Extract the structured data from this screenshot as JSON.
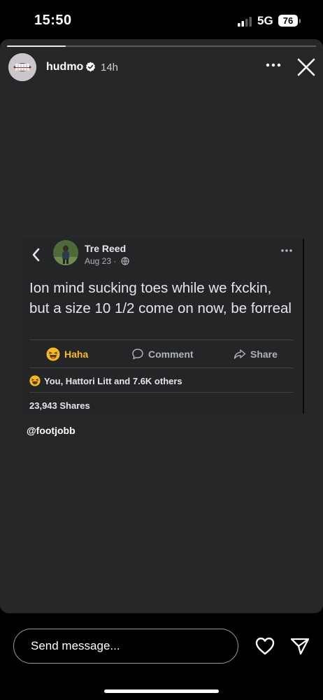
{
  "status_bar": {
    "time": "15:50",
    "network": "5G",
    "battery": "76"
  },
  "story": {
    "progress": 0.19,
    "username": "hudmo",
    "time_ago": "14h",
    "mention": "@footjobb"
  },
  "post": {
    "author": "Tre Reed",
    "date": "Aug 23 ·",
    "text": "Ion mind sucking toes while we fxckin, but a size 10 1/2 come on now, be forreal",
    "actions": {
      "haha": "Haha",
      "comment": "Comment",
      "share": "Share"
    },
    "reactions": "You, Hattori Litt and 7.6K others",
    "shares": "23,943 Shares"
  },
  "reply": {
    "placeholder": "Send message..."
  },
  "colors": {
    "haha": "#f7b928",
    "story_bg": "#272729",
    "post_bg": "#242526"
  },
  "icons": [
    "signal-icon",
    "verified-icon",
    "more-icon",
    "close-icon",
    "back-icon",
    "globe-icon",
    "haha-icon",
    "comment-icon",
    "share-icon",
    "heart-icon",
    "send-icon"
  ]
}
